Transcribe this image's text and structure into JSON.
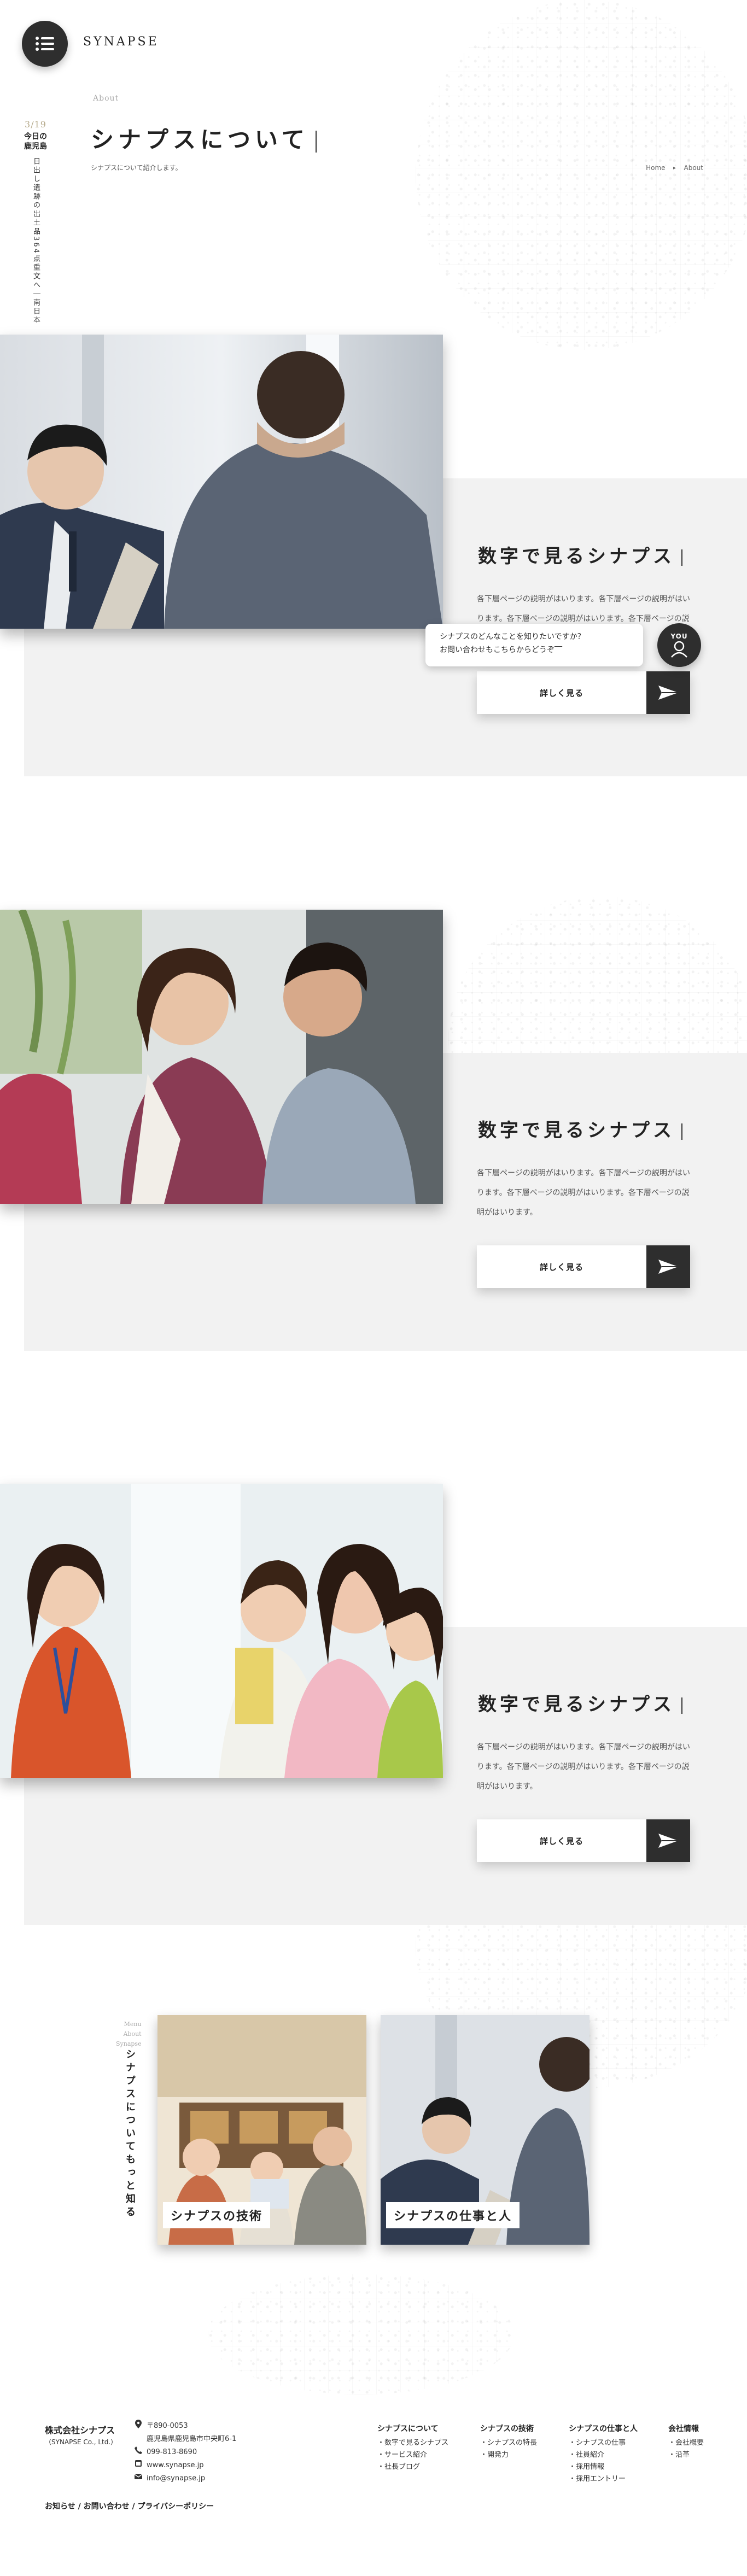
{
  "header": {
    "logo": "SYNAPSE",
    "date": "3/19",
    "today": "今日の",
    "city": "鹿児島",
    "vertical_text": "日出し遺跡の出土品364点重文へ｜南日本"
  },
  "page": {
    "section_en": "About",
    "title": "シナプスについて",
    "subtitle": "シナプスについて紹介します。",
    "breadcrumb": {
      "home": "Home",
      "separator": "▸",
      "current": "About"
    }
  },
  "sections": [
    {
      "title": "数字で見るシナプス",
      "desc": "各下層ページの説明がはいります。各下層ページの説明がはいります。各下層ページの説明がはいります。各下層ページの説明がはいります。",
      "button": "詳しく見る"
    },
    {
      "title": "数字で見るシナプス",
      "desc": "各下層ページの説明がはいります。各下層ページの説明がはいります。各下層ページの説明がはいります。各下層ページの説明がはいります。",
      "button": "詳しく見る"
    },
    {
      "title": "数字で見るシナプス",
      "desc": "各下層ページの説明がはいります。各下層ページの説明がはいります。各下層ページの説明がはいります。各下層ページの説明がはいります。",
      "button": "詳しく見る"
    }
  ],
  "chat": {
    "line1": "シナプスのどんなことを知りたいですか？",
    "line2": "お問い合わせもこちらからどうぞ‾‾",
    "avatar_label": "YOU"
  },
  "related": {
    "side_small": [
      "Menu",
      "About",
      "Synapse"
    ],
    "side_title": "シナプスについてもっと知る",
    "cards": [
      {
        "label": "シナプスの技術"
      },
      {
        "label": "シナプスの仕事と人"
      }
    ]
  },
  "footer": {
    "company": "株式会社シナプス",
    "company_en": "（SYNAPSE Co., Ltd.）",
    "address_zip": "〒890-0053",
    "address": "鹿児島県鹿児島市中央町6-1",
    "phone": "099-813-8690",
    "web": "www.synapse.jp",
    "email": "info@synapse.jp",
    "nav": [
      {
        "head": "シナプスについて",
        "items": [
          "・数字で見るシナプス",
          "・サービス紹介",
          "・社長ブログ"
        ]
      },
      {
        "head": "シナプスの技術",
        "items": [
          "・シナプスの特長",
          "・開発力"
        ]
      },
      {
        "head": "シナプスの仕事と人",
        "items": [
          "・シナプスの仕事",
          "・社員紹介",
          "・採用情報",
          "・採用エントリー"
        ]
      },
      {
        "head": "会社情報",
        "items": [
          "・会社概要",
          "・沿革"
        ]
      }
    ],
    "bottom": "お知らせ / お問い合わせ / プライバシーポリシー"
  },
  "colors": {
    "dark": "#2e2e2e",
    "panel": "#f2f2f2",
    "accent": "#b5a98a"
  }
}
